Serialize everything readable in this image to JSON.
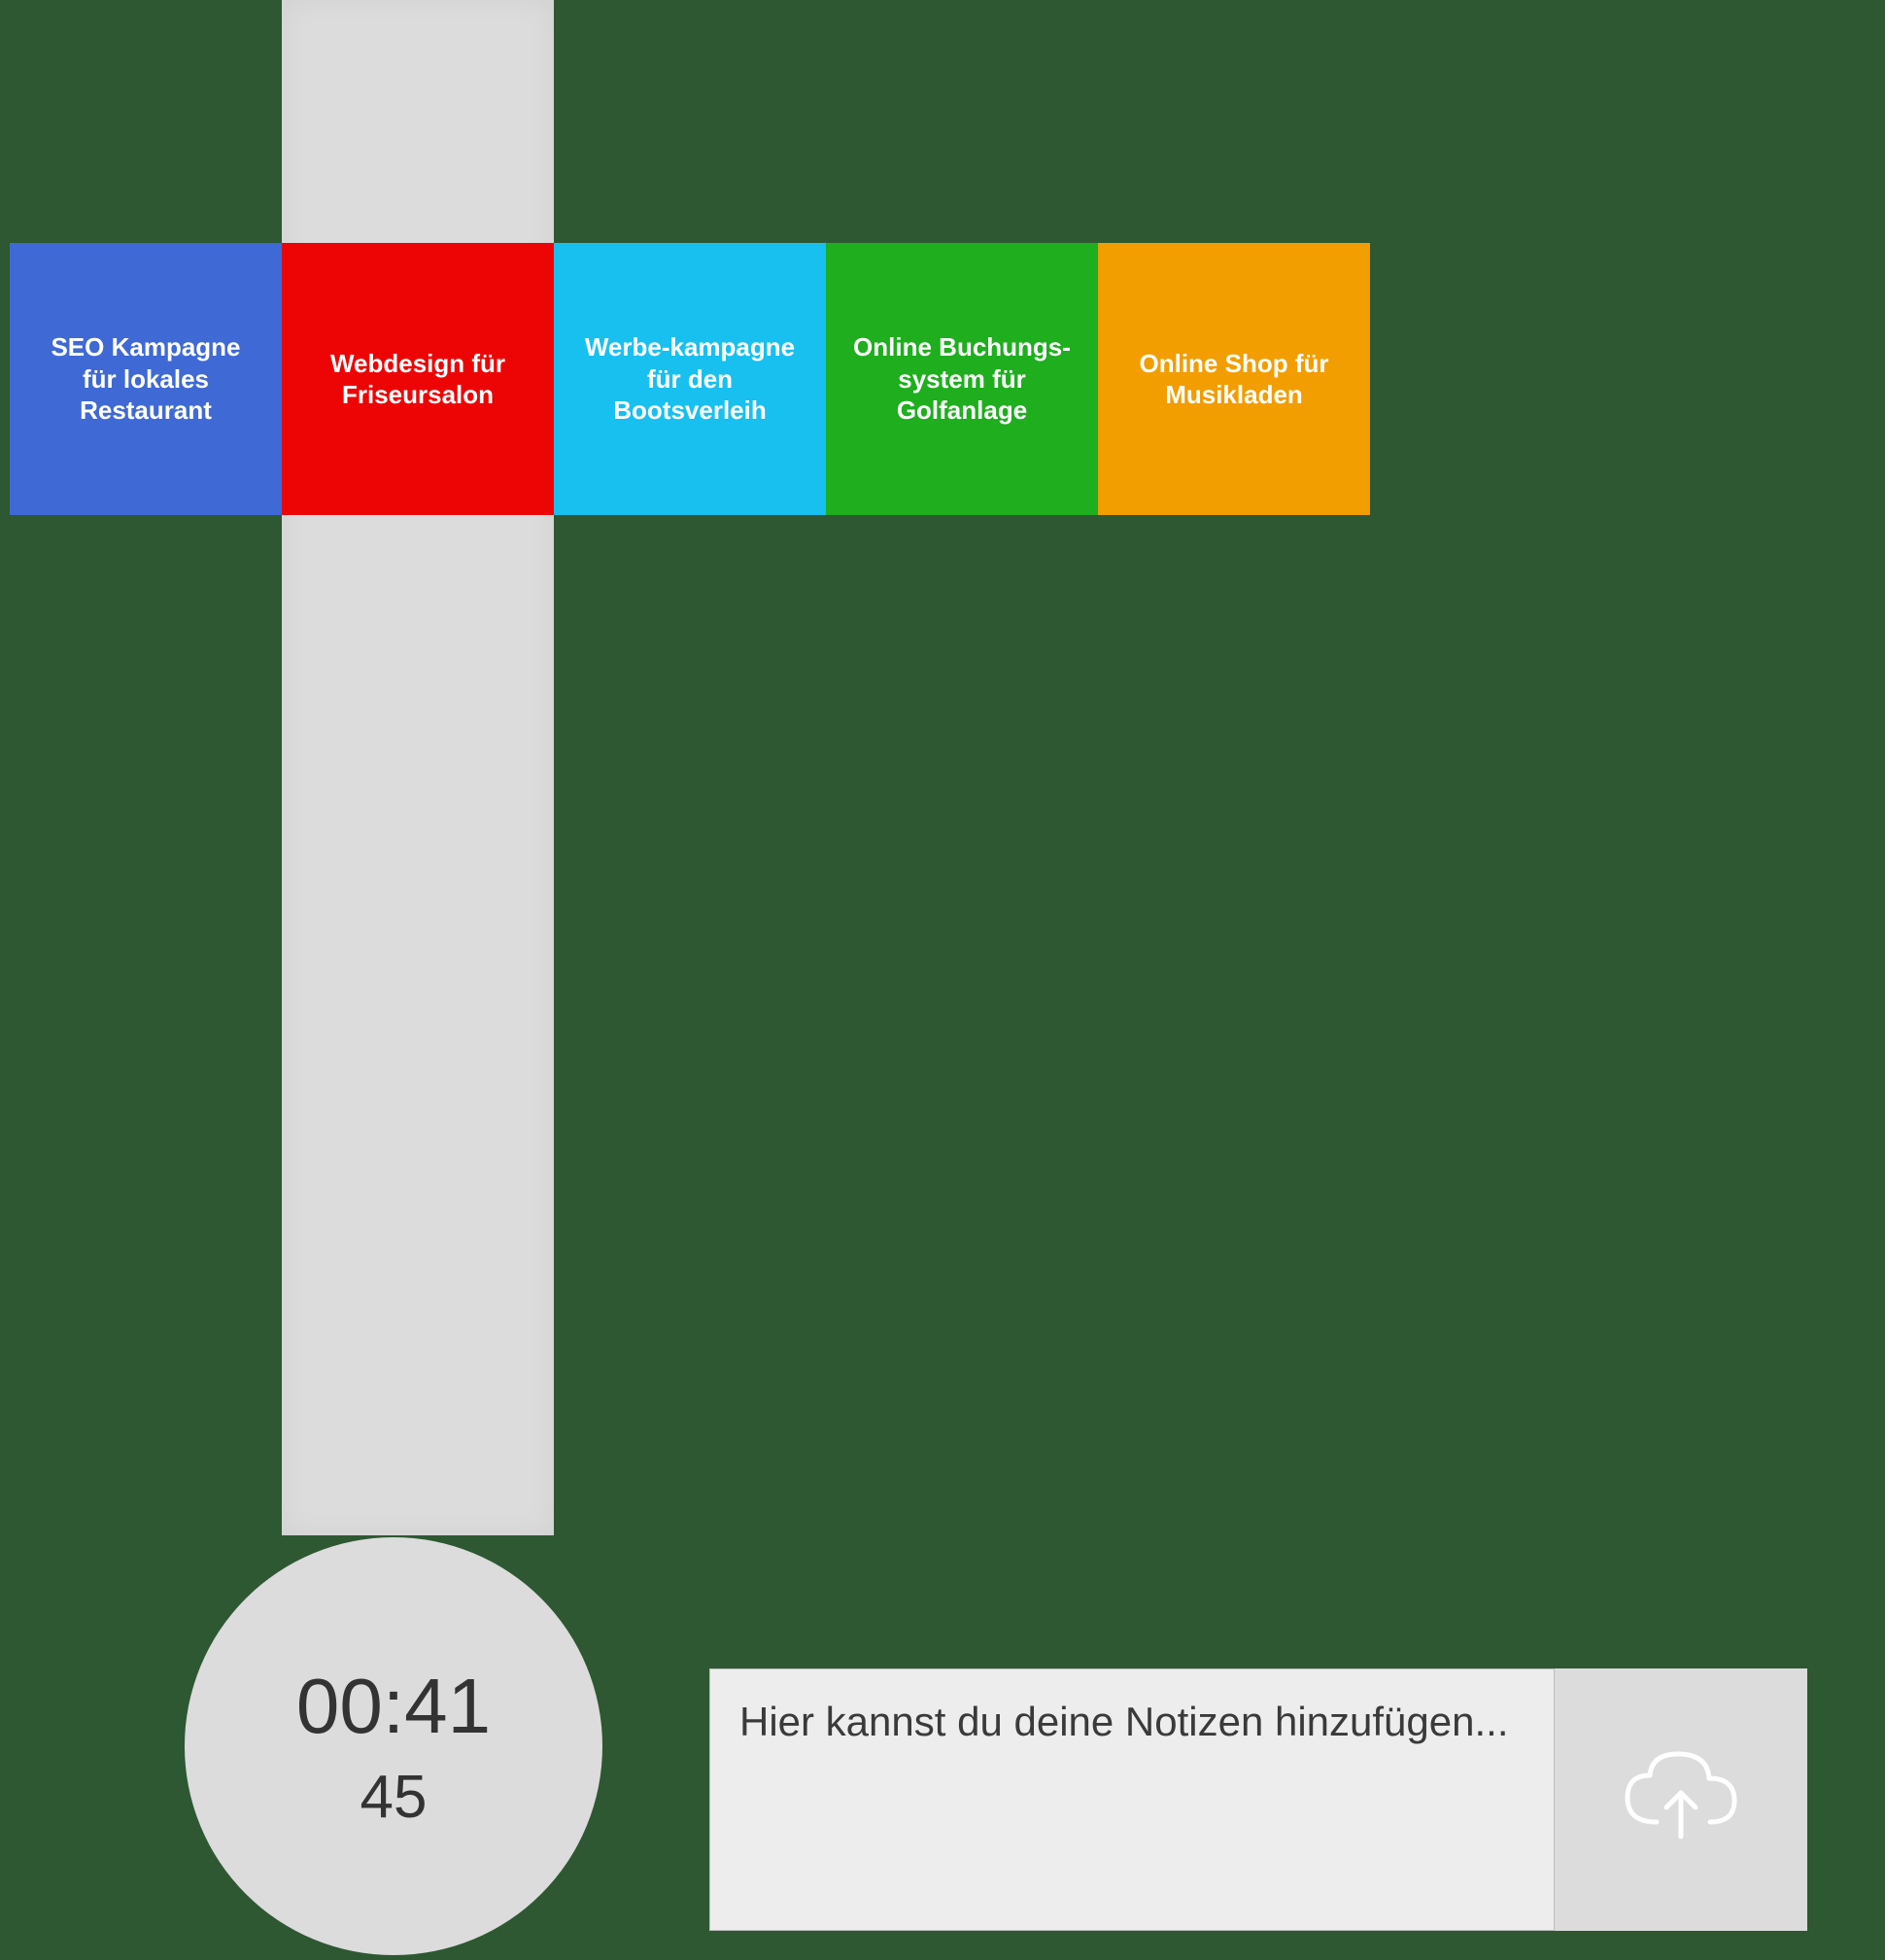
{
  "tiles": [
    {
      "label": "SEO Kampagne für lokales Restaurant",
      "color": "blue"
    },
    {
      "label": "Webdesign für Friseursalon",
      "color": "red"
    },
    {
      "label": "Werbe-kampagne für den Bootsverleih",
      "color": "cyan"
    },
    {
      "label": "Online Buchungs-system für Golfanlage",
      "color": "green"
    },
    {
      "label": "Online Shop für Musikladen",
      "color": "orange"
    }
  ],
  "timer": {
    "main": "00:41",
    "sub": "45"
  },
  "notes": {
    "placeholder": "Hier kannst du deine Notizen hinzufügen...",
    "value": ""
  }
}
